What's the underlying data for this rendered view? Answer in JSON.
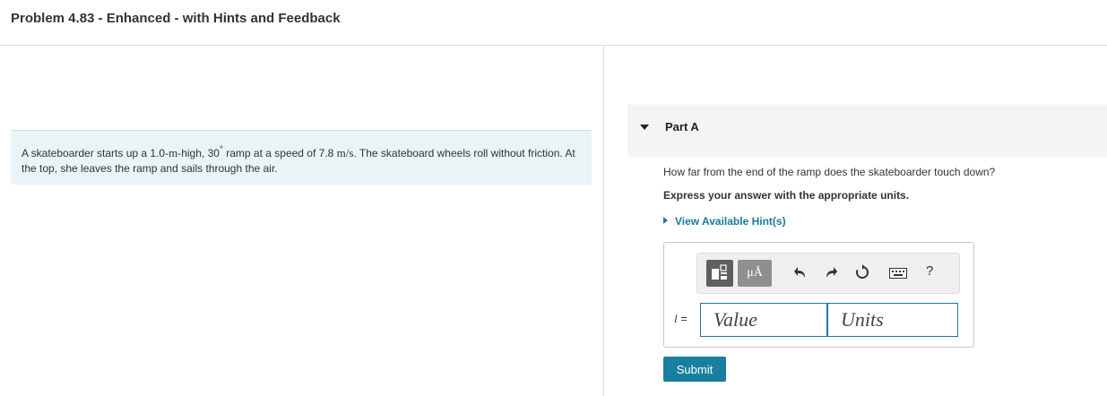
{
  "header": {
    "title": "Problem 4.83 - Enhanced - with Hints and Feedback"
  },
  "problem": {
    "text_1": "A skateboarder starts up a 1.0-",
    "unit_m": "m",
    "text_2": "-high, 30",
    "deg": "°",
    "text_3": " ramp at a speed of 7.8 ",
    "unit_speed": "m/s",
    "text_4": ". The skateboard wheels roll without friction. At the top, she leaves the ramp and sails through the air."
  },
  "part": {
    "label": "Part A"
  },
  "question": "How far from the end of the ramp does the skateboarder touch down?",
  "instruction": "Express your answer with the appropriate units.",
  "hint_link": "View Available Hint(s)",
  "toolbar": {
    "units_label": "μÅ",
    "help_label": "?"
  },
  "answer": {
    "variable": "l",
    "equals": " =",
    "value_placeholder": "Value",
    "units_placeholder": "Units"
  },
  "submit_label": "Submit",
  "colors": {
    "accent": "#197fa0",
    "problem_bg": "#e8f4f5"
  }
}
